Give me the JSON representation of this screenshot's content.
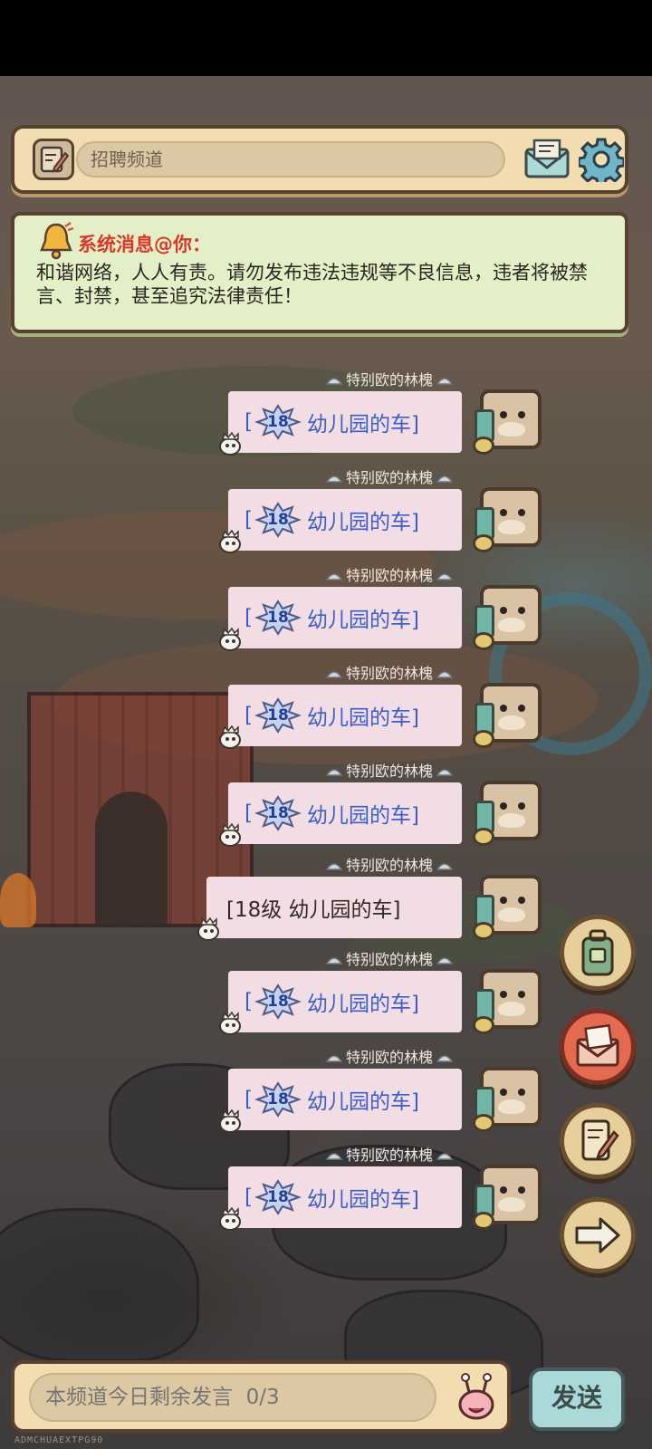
{
  "topbar": {
    "channel_name": "招聘频道",
    "channel_icon": "edit-note-icon",
    "mail_icon": "mail-icon",
    "settings_icon": "gear-icon"
  },
  "notice": {
    "title": "系统消息@你：",
    "body": "和谐网络，人人有责。请勿发布违法违规等不良信息，违者将被禁言、封禁，甚至追究法律责任！",
    "icon": "bell-icon"
  },
  "messages": [
    {
      "sender": "特别欧的林槐",
      "level": "18",
      "text": "幼儿园的车]",
      "style": "badge"
    },
    {
      "sender": "特别欧的林槐",
      "level": "18",
      "text": "幼儿园的车]",
      "style": "badge"
    },
    {
      "sender": "特别欧的林槐",
      "level": "18",
      "text": "幼儿园的车]",
      "style": "badge"
    },
    {
      "sender": "特别欧的林槐",
      "level": "18",
      "text": "幼儿园的车]",
      "style": "badge"
    },
    {
      "sender": "特别欧的林槐",
      "level": "18",
      "text": "幼儿园的车]",
      "style": "badge"
    },
    {
      "sender": "特别欧的林槐",
      "text": "[18级  幼儿园的车]",
      "style": "plain"
    },
    {
      "sender": "特别欧的林槐",
      "level": "18",
      "text": "幼儿园的车]",
      "style": "badge"
    },
    {
      "sender": "特别欧的林槐",
      "level": "18",
      "text": "幼儿园的车]",
      "style": "badge"
    },
    {
      "sender": "特别欧的林槐",
      "level": "18",
      "text": "幼儿园的车]",
      "style": "badge"
    }
  ],
  "side_buttons": [
    "backpack-icon",
    "mail-letter-icon",
    "scroll-edit-icon",
    "arrow-right-icon"
  ],
  "input": {
    "placeholder": "本频道今日剩余发言  0/3"
  },
  "send_label": "发送",
  "watermark": "ADMCHUAEXTPG90",
  "colors": {
    "panel": "#f2ddb0",
    "notice_bg": "#e3f0c7",
    "notice_title": "#d9382a",
    "bubble_bg": "#f2dde4",
    "bubble_text": "#3b5fc4",
    "send_bg": "#a9d9d8"
  }
}
